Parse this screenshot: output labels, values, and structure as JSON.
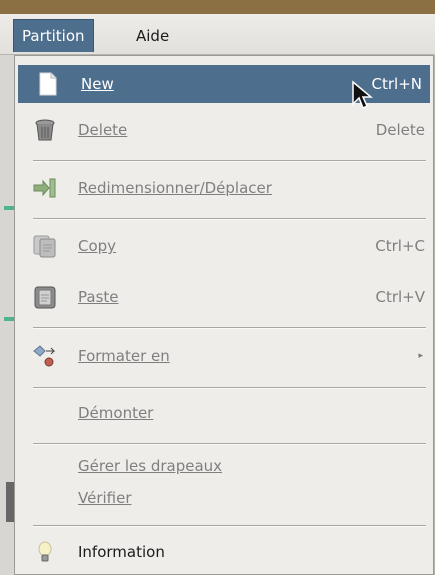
{
  "menubar": {
    "items": [
      {
        "label": "Partition",
        "active": true
      },
      {
        "label": "Aide",
        "active": false
      }
    ]
  },
  "menu": {
    "items": [
      {
        "label": "New",
        "accel": "Ctrl+N",
        "state": "highlighted",
        "icon": "new-document-icon"
      },
      {
        "label": "Delete",
        "accel": "Delete",
        "state": "disabled",
        "icon": "trash-icon"
      },
      {
        "label": "Redimensionner/Déplacer",
        "accel": "",
        "state": "disabled",
        "icon": "resize-move-icon"
      },
      {
        "label": "Copy",
        "accel": "Ctrl+C",
        "state": "disabled",
        "icon": "copy-icon"
      },
      {
        "label": "Paste",
        "accel": "Ctrl+V",
        "state": "disabled",
        "icon": "paste-icon"
      },
      {
        "label": "Formater en",
        "accel": "",
        "state": "disabled",
        "icon": "format-icon",
        "submenu": true
      },
      {
        "label": "Démonter",
        "accel": "",
        "state": "disabled"
      },
      {
        "label": "Gérer les drapeaux",
        "accel": "",
        "state": "disabled"
      },
      {
        "label": "Vérifier",
        "accel": "",
        "state": "disabled"
      },
      {
        "label": "Information",
        "accel": "",
        "state": "enabled",
        "icon": "info-bulb-icon"
      }
    ]
  },
  "colors": {
    "highlight": "#4e6e8d",
    "menu_bg": "#efedea",
    "disabled_text": "#7f7f7f"
  }
}
